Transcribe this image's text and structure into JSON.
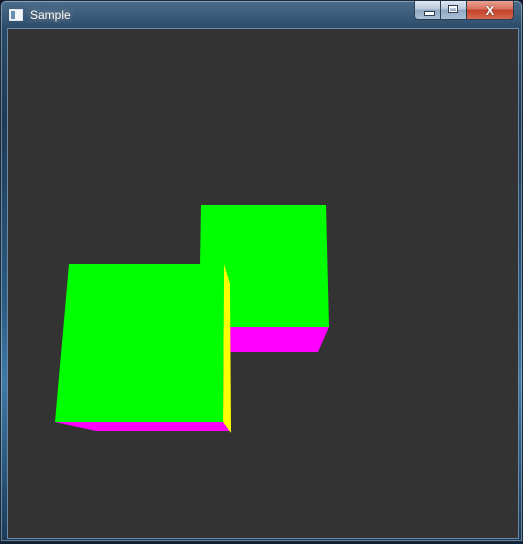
{
  "window": {
    "title": "Sample",
    "icon": "app-window-icon",
    "buttons": {
      "minimize": "minimize-icon",
      "maximize": "maximize-icon",
      "close_glyph": "X"
    }
  },
  "scene": {
    "background": "#333333",
    "face_colors": {
      "front": "#00ff00",
      "bottom": "#ff00ff",
      "side": "#ffff00"
    },
    "objects": [
      "cube-back",
      "cube-front"
    ]
  }
}
